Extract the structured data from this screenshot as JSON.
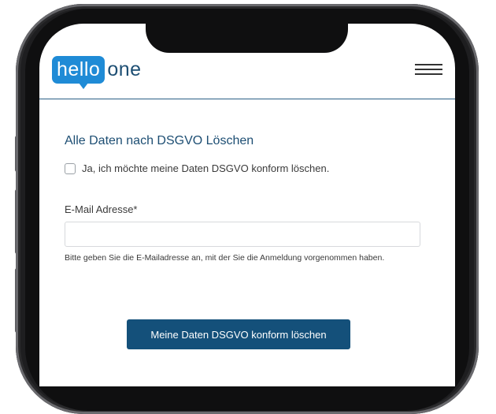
{
  "header": {
    "logo_part1": "hello",
    "logo_part2": "one",
    "menu_icon": "hamburger-menu-icon"
  },
  "form": {
    "title": "Alle Daten nach DSGVO Löschen",
    "consent_label": "Ja, ich möchte meine Daten DSGVO konform löschen.",
    "consent_checked": false,
    "email_label": "E-Mail Adresse*",
    "email_value": "",
    "help_text": "Bitte geben Sie die E-Mailadresse an, mit der Sie die Anmeldung vorgenommen haben.",
    "submit_label": "Meine Daten DSGVO konform löschen"
  },
  "colors": {
    "brand_blue": "#1f8bd6",
    "dark_blue": "#1d4e73",
    "button_blue": "#14507a"
  }
}
